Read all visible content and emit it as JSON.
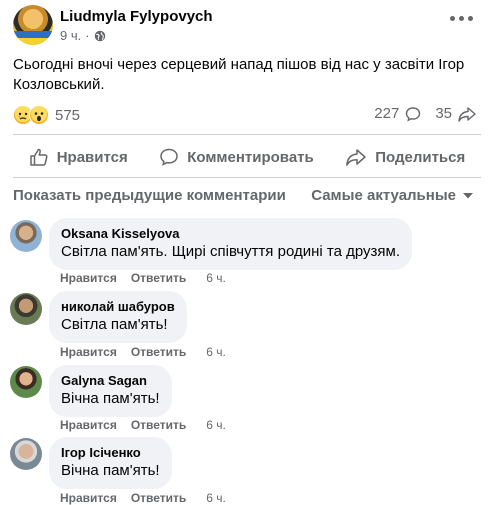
{
  "post": {
    "author": "Liudmyla Fylypovych",
    "time": "9 ч.",
    "text": "Сьогодні вночі через серцевий напад пішов від нас у засвіти Ігор Козловський.",
    "reaction_count": "575",
    "comment_count": "227",
    "share_count": "35"
  },
  "actions": {
    "like": "Нравится",
    "comment": "Комментировать",
    "share": "Поделиться"
  },
  "comments_header": {
    "prev": "Показать предыдущие комментарии",
    "sort": "Самые актуальные"
  },
  "comments": [
    {
      "name": "Oksana Kisselyova",
      "text": "Світла пам'ять. Щирі співчуття родині та друзям.",
      "like": "Нравится",
      "reply": "Ответить",
      "time": "6 ч."
    },
    {
      "name": "николай шабуров",
      "text": "Світла пам'ять!",
      "like": "Нравится",
      "reply": "Ответить",
      "time": "6 ч."
    },
    {
      "name": "Galyna Sagan",
      "text": "Вічна пам'ять!",
      "like": "Нравится",
      "reply": "Ответить",
      "time": "6 ч."
    },
    {
      "name": "Ігор Ісіченко",
      "text": "Вічна пам'ять!",
      "like": "Нравится",
      "reply": "Ответить",
      "time": "6 ч."
    }
  ],
  "icons": {
    "more": "more-horizontal-icon",
    "globe": "globe-icon",
    "comment": "comment-bubble-icon",
    "share": "share-arrow-icon",
    "like": "thumbs-up-icon",
    "sort": "chevron-down-icon"
  },
  "colors": {
    "secondary_text": "#65676b",
    "bubble": "#f0f2f5",
    "divider": "#ced0d4"
  }
}
